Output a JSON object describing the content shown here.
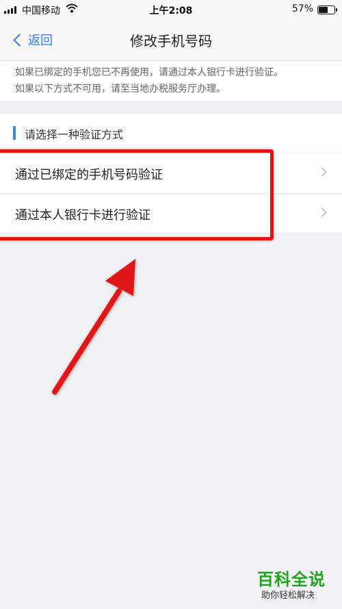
{
  "status_bar": {
    "carrier": "中国移动",
    "time": "上午2:08",
    "battery_percent": "57%",
    "battery_level": 0.57
  },
  "nav": {
    "back_label": "返回",
    "title": "修改手机号码"
  },
  "notice": {
    "line1": "如果已绑定的手机您已不再使用，请通过本人银行卡进行验证。",
    "line2": "如果以下方式不可用，请至当地办税服务厅办理。"
  },
  "section": {
    "title": "请选择一种验证方式",
    "accent_color": "#3a86e6",
    "options": [
      {
        "label": "通过已绑定的手机号码验证"
      },
      {
        "label": "通过本人银行卡进行验证"
      }
    ]
  },
  "annotation": {
    "color": "#e11414"
  },
  "watermark": {
    "main": "百科全说",
    "sub": "助你轻松解决"
  }
}
